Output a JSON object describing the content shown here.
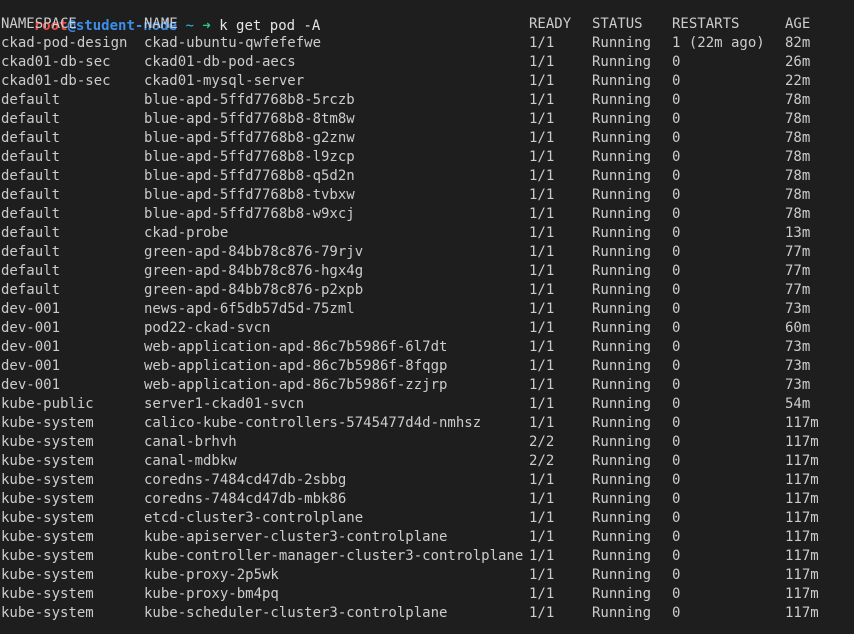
{
  "colors": {
    "background": "#1e1e1e",
    "foreground": "#cccccc",
    "prompt_user": "#f14c4c",
    "prompt_host": "#3b8eea",
    "prompt_arrow": "#23d18b"
  },
  "prompt": {
    "user": "root",
    "at": "@",
    "host": "student-node",
    "dir": " ~ ",
    "arrow": "➜",
    "command": " k get pod -A"
  },
  "table": {
    "headers": [
      "NAMESPACE",
      "NAME",
      "READY",
      "STATUS",
      "RESTARTS",
      "AGE"
    ],
    "rows": [
      [
        "ckad-pod-design",
        "ckad-ubuntu-qwfefefwe",
        "1/1",
        "Running",
        "1 (22m ago)",
        "82m"
      ],
      [
        "ckad01-db-sec",
        "ckad01-db-pod-aecs",
        "1/1",
        "Running",
        "0",
        "26m"
      ],
      [
        "ckad01-db-sec",
        "ckad01-mysql-server",
        "1/1",
        "Running",
        "0",
        "22m"
      ],
      [
        "default",
        "blue-apd-5ffd7768b8-5rczb",
        "1/1",
        "Running",
        "0",
        "78m"
      ],
      [
        "default",
        "blue-apd-5ffd7768b8-8tm8w",
        "1/1",
        "Running",
        "0",
        "78m"
      ],
      [
        "default",
        "blue-apd-5ffd7768b8-g2znw",
        "1/1",
        "Running",
        "0",
        "78m"
      ],
      [
        "default",
        "blue-apd-5ffd7768b8-l9zcp",
        "1/1",
        "Running",
        "0",
        "78m"
      ],
      [
        "default",
        "blue-apd-5ffd7768b8-q5d2n",
        "1/1",
        "Running",
        "0",
        "78m"
      ],
      [
        "default",
        "blue-apd-5ffd7768b8-tvbxw",
        "1/1",
        "Running",
        "0",
        "78m"
      ],
      [
        "default",
        "blue-apd-5ffd7768b8-w9xcj",
        "1/1",
        "Running",
        "0",
        "78m"
      ],
      [
        "default",
        "ckad-probe",
        "1/1",
        "Running",
        "0",
        "13m"
      ],
      [
        "default",
        "green-apd-84bb78c876-79rjv",
        "1/1",
        "Running",
        "0",
        "77m"
      ],
      [
        "default",
        "green-apd-84bb78c876-hgx4g",
        "1/1",
        "Running",
        "0",
        "77m"
      ],
      [
        "default",
        "green-apd-84bb78c876-p2xpb",
        "1/1",
        "Running",
        "0",
        "77m"
      ],
      [
        "dev-001",
        "news-apd-6f5db57d5d-75zml",
        "1/1",
        "Running",
        "0",
        "73m"
      ],
      [
        "dev-001",
        "pod22-ckad-svcn",
        "1/1",
        "Running",
        "0",
        "60m"
      ],
      [
        "dev-001",
        "web-application-apd-86c7b5986f-6l7dt",
        "1/1",
        "Running",
        "0",
        "73m"
      ],
      [
        "dev-001",
        "web-application-apd-86c7b5986f-8fqgp",
        "1/1",
        "Running",
        "0",
        "73m"
      ],
      [
        "dev-001",
        "web-application-apd-86c7b5986f-zzjrp",
        "1/1",
        "Running",
        "0",
        "73m"
      ],
      [
        "kube-public",
        "server1-ckad01-svcn",
        "1/1",
        "Running",
        "0",
        "54m"
      ],
      [
        "kube-system",
        "calico-kube-controllers-5745477d4d-nmhsz",
        "1/1",
        "Running",
        "0",
        "117m"
      ],
      [
        "kube-system",
        "canal-brhvh",
        "2/2",
        "Running",
        "0",
        "117m"
      ],
      [
        "kube-system",
        "canal-mdbkw",
        "2/2",
        "Running",
        "0",
        "117m"
      ],
      [
        "kube-system",
        "coredns-7484cd47db-2sbbg",
        "1/1",
        "Running",
        "0",
        "117m"
      ],
      [
        "kube-system",
        "coredns-7484cd47db-mbk86",
        "1/1",
        "Running",
        "0",
        "117m"
      ],
      [
        "kube-system",
        "etcd-cluster3-controlplane",
        "1/1",
        "Running",
        "0",
        "117m"
      ],
      [
        "kube-system",
        "kube-apiserver-cluster3-controlplane",
        "1/1",
        "Running",
        "0",
        "117m"
      ],
      [
        "kube-system",
        "kube-controller-manager-cluster3-controlplane",
        "1/1",
        "Running",
        "0",
        "117m"
      ],
      [
        "kube-system",
        "kube-proxy-2p5wk",
        "1/1",
        "Running",
        "0",
        "117m"
      ],
      [
        "kube-system",
        "kube-proxy-bm4pq",
        "1/1",
        "Running",
        "0",
        "117m"
      ],
      [
        "kube-system",
        "kube-scheduler-cluster3-controlplane",
        "1/1",
        "Running",
        "0",
        "117m"
      ]
    ]
  }
}
